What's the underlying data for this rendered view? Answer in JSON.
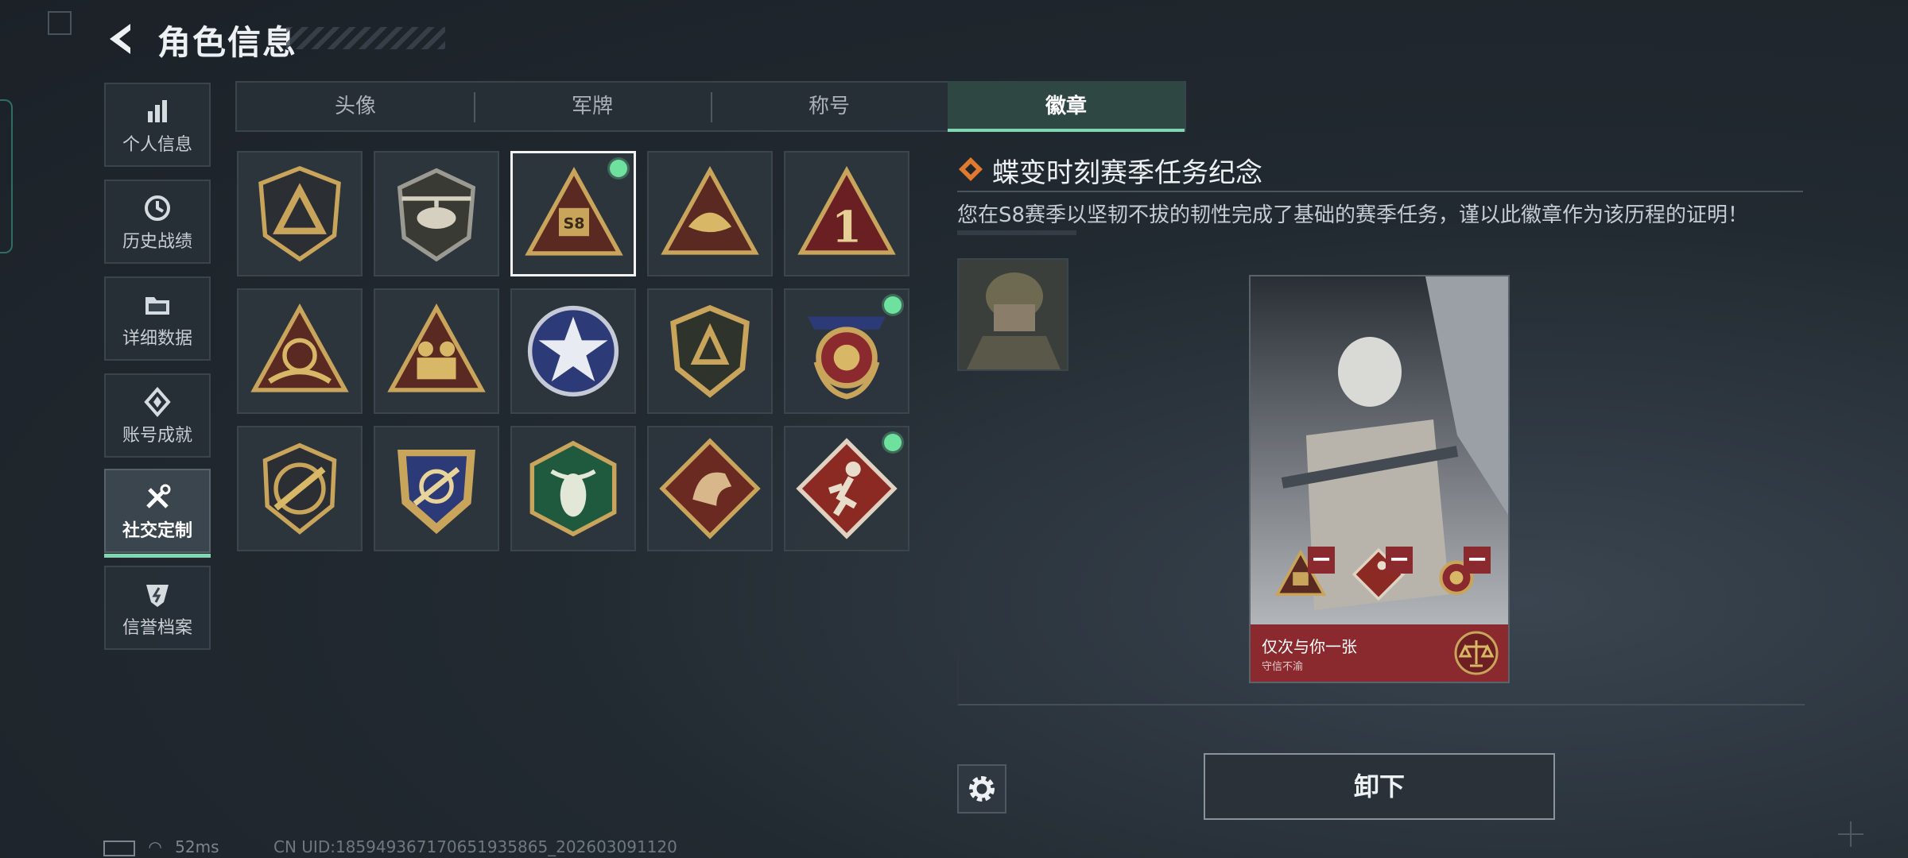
{
  "header": {
    "title": "角色信息"
  },
  "nav": {
    "items": [
      {
        "label": "个人信息",
        "icon": "bar-chart-icon"
      },
      {
        "label": "历史战绩",
        "icon": "history-icon"
      },
      {
        "label": "详细数据",
        "icon": "folder-icon"
      },
      {
        "label": "账号成就",
        "icon": "achievement-icon"
      },
      {
        "label": "社交定制",
        "icon": "tools-icon",
        "active": true
      },
      {
        "label": "信誉档案",
        "icon": "credit-icon"
      }
    ]
  },
  "tabs": [
    {
      "label": "头像"
    },
    {
      "label": "军牌"
    },
    {
      "label": "称号"
    },
    {
      "label": "徽章",
      "active": true
    }
  ],
  "badges": [
    {
      "name": "triangle-shield-badge",
      "equipped": false
    },
    {
      "name": "helicopter-badge",
      "equipped": false
    },
    {
      "name": "s8-season-badge",
      "equipped": true,
      "selected": true,
      "text": "S8"
    },
    {
      "name": "butterfly-triangle-badge",
      "equipped": false
    },
    {
      "name": "number-one-badge",
      "equipped": false,
      "text": "1"
    },
    {
      "name": "hands-triangle-badge",
      "equipped": false
    },
    {
      "name": "soldiers-triangle-badge",
      "equipped": false
    },
    {
      "name": "star-emblem-badge",
      "equipped": false
    },
    {
      "name": "shield-emblem-badge",
      "equipped": false
    },
    {
      "name": "laurel-shield-badge",
      "equipped": true
    },
    {
      "name": "rifle-circle-badge",
      "equipped": false
    },
    {
      "name": "crosshair-shield-badge",
      "equipped": false
    },
    {
      "name": "insect-hexagon-badge",
      "equipped": false
    },
    {
      "name": "dragon-diamond-badge",
      "equipped": false
    },
    {
      "name": "runner-diamond-badge",
      "equipped": true
    }
  ],
  "detail": {
    "title": "蝶变时刻赛季任务纪念",
    "description": "您在S8赛季以坚韧不拔的韧性完成了基础的赛季任务，谨以此徽章作为该历程的证明！"
  },
  "card": {
    "name": "仅次与你一张",
    "subtitle": "守信不渝"
  },
  "actions": {
    "unequip_label": "卸下"
  },
  "status": {
    "ping": "52ms",
    "uid": "CN UID:1859493671706519358​65_202603091120"
  },
  "colors": {
    "accent": "#7fd6b0",
    "equipped_dot": "#6ee19e",
    "card_red": "#8b2a2e",
    "badge_gold": "#c9a55c"
  }
}
